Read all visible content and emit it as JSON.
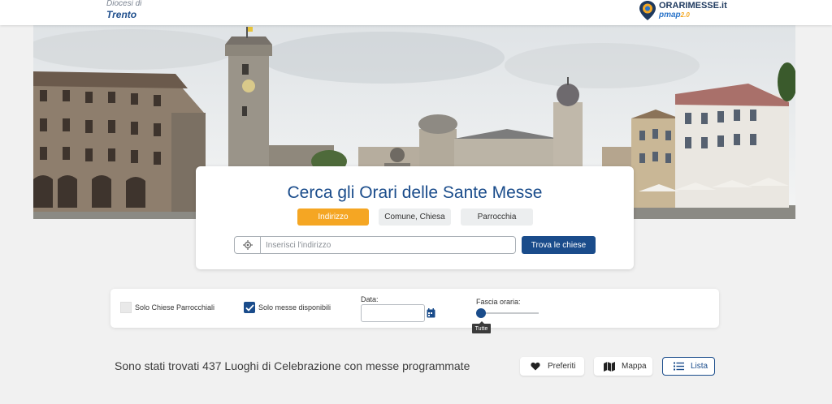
{
  "header": {
    "diocese_line1": "Diocesi di",
    "diocese_line2": "Trento",
    "brand_name": "ORARIMESSE.it",
    "brand_product": "pmap",
    "brand_version": "2.0"
  },
  "search": {
    "title": "Cerca gli Orari delle Sante Messe",
    "tabs": [
      {
        "label": "Indirizzo",
        "active": true
      },
      {
        "label": "Comune, Chiesa",
        "active": false
      },
      {
        "label": "Parrocchia",
        "active": false
      }
    ],
    "address_placeholder": "Inserisci l'indirizzo",
    "address_value": "",
    "find_button": "Trova le chiese"
  },
  "filters": {
    "parish_only_label": "Solo Chiese Parrocchiali",
    "parish_only_checked": false,
    "available_only_label": "Solo messe disponibili",
    "available_only_checked": true,
    "date_label": "Data:",
    "date_value": "",
    "time_slot_label": "Fascia oraria:",
    "time_slot_value": "Tutte"
  },
  "results": {
    "summary": "Sono stati trovati 437 Luoghi di Celebrazione con messe programmate",
    "views": [
      {
        "label": "Preferiti",
        "icon": "heart-icon"
      },
      {
        "label": "Mappa",
        "icon": "map-icon"
      },
      {
        "label": "Lista",
        "icon": "list-icon",
        "active": true
      }
    ]
  },
  "colors": {
    "primary_blue": "#1a4c8b",
    "accent_orange": "#f5a623",
    "background": "#f1f1f1"
  }
}
